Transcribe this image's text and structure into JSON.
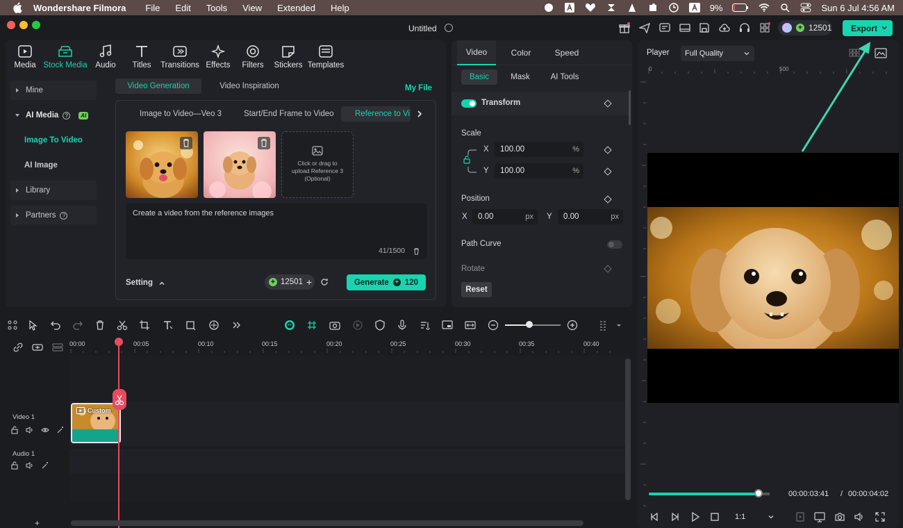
{
  "menubar": {
    "app_name": "Wondershare Filmora",
    "items": [
      "File",
      "Edit",
      "Tools",
      "View",
      "Extended",
      "Help"
    ],
    "battery": "9%",
    "datetime": "Sun 6 Jul  4:56 AM"
  },
  "titlebar": {
    "doc_title": "Untitled",
    "credits": "12501",
    "export_label": "Export"
  },
  "top_tabs": [
    "Media",
    "Stock Media",
    "Audio",
    "Titles",
    "Transitions",
    "Effects",
    "Filters",
    "Stickers",
    "Templates"
  ],
  "top_tabs_active": "Stock Media",
  "side_nav": {
    "mine": "Mine",
    "ai_media": "AI Media",
    "ai_badge": "AI",
    "image_to_video": "Image To Video",
    "ai_image": "AI Image",
    "library": "Library",
    "partners": "Partners"
  },
  "gen": {
    "tab_generation": "Video Generation",
    "tab_inspiration": "Video Inspiration",
    "my_file": "My File",
    "mode_1": "Image to Video—Veo 3",
    "mode_2": "Start/End Frame to Video",
    "mode_3": "Reference to Vi",
    "upload_text": "Click or drag to upload Reference 3 (Optional)",
    "prompt": "Create a video from the reference images",
    "char_count": "41/1500",
    "setting": "Setting",
    "credits": "12501",
    "generate_label": "Generate",
    "generate_cost": "120"
  },
  "props": {
    "tab_video": "Video",
    "tab_color": "Color",
    "tab_speed": "Speed",
    "sub_basic": "Basic",
    "sub_mask": "Mask",
    "sub_ai_tools": "AI Tools",
    "transform": "Transform",
    "scale": "Scale",
    "scale_x": "100.00",
    "scale_y": "100.00",
    "percent": "%",
    "x": "X",
    "y": "Y",
    "position": "Position",
    "pos_x": "0.00",
    "pos_y": "0.00",
    "px": "px",
    "path_curve": "Path Curve",
    "rotate": "Rotate",
    "reset": "Reset"
  },
  "player": {
    "label": "Player",
    "quality": "Full Quality",
    "ruler_0": "0",
    "ruler_500": "500",
    "time_current": "00:00:03:41",
    "time_sep": "/",
    "time_total": "00:00:04:02",
    "ratio": "1:1",
    "progress_fraction": 0.91
  },
  "timeline": {
    "ticks": [
      "00:00",
      "00:05",
      "00:10",
      "00:15",
      "00:20",
      "00:25",
      "00:30",
      "00:35",
      "00:40"
    ],
    "video_track": "Video 1",
    "audio_track": "Audio 1",
    "clip_label": "Custom",
    "add_track": "+"
  },
  "colors": {
    "accent": "#19d3ae",
    "playhead": "#e84a5f",
    "menubar": "#5b4a47"
  }
}
